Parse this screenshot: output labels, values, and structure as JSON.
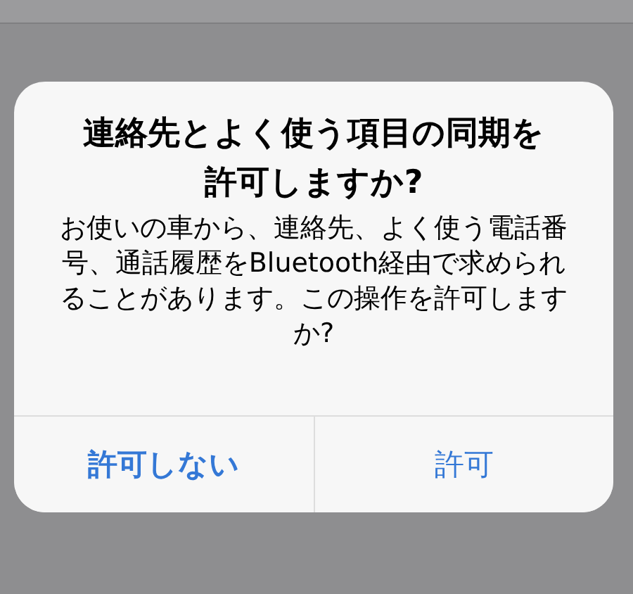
{
  "alert": {
    "title": "連絡先とよく使う項目の同期を許可しますか?",
    "message": "お使いの車から、連絡先、よく使う電話番号、通話履歴をBluetooth経由で求められることがあります。この操作を許可しますか?",
    "buttons": [
      {
        "label": "許可しない",
        "kind": "preferred"
      },
      {
        "label": "許可",
        "kind": "normal"
      }
    ]
  }
}
